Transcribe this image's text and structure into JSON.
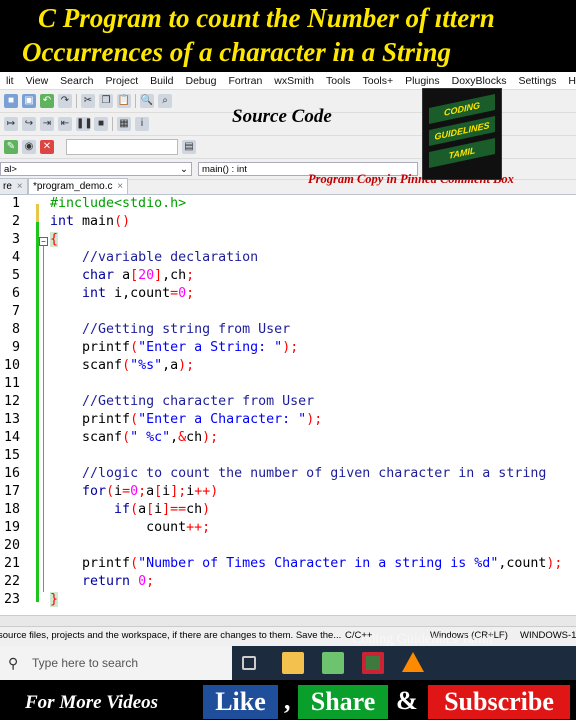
{
  "banner": {
    "line1": "C Program to count the Number of ıttern",
    "line2": "Occurrences of a character in a String"
  },
  "menu": [
    "lit",
    "View",
    "Search",
    "Project",
    "Build",
    "Debug",
    "Fortran",
    "wxSmith",
    "Tools",
    "Tools+",
    "Plugins",
    "DoxyBlocks",
    "Settings",
    "Help"
  ],
  "toolbar_combo": {
    "scope_value": "al>",
    "function_value": "main() : int"
  },
  "tabs": [
    {
      "label": "re",
      "close": "×"
    },
    {
      "label": "*program_demo.c",
      "close": "×"
    }
  ],
  "overlay": {
    "source_code_title": "Source Code",
    "pinned_note": "Program Copy in Pinned Comment Box"
  },
  "logo": {
    "line1": "CODING",
    "line2": "GUIDELINES",
    "line3": "TAMIL"
  },
  "code": {
    "line_numbers": [
      "1",
      "2",
      "3",
      "4",
      "5",
      "6",
      "7",
      "8",
      "9",
      "10",
      "11",
      "12",
      "13",
      "14",
      "15",
      "16",
      "17",
      "18",
      "19",
      "20",
      "21",
      "22",
      "23"
    ]
  },
  "statusbar": {
    "message": "source files, projects and the workspace, if there are changes to them. Save the...",
    "language": "C/C++",
    "eol": "Windows (CR+LF)",
    "encoding": "WINDOWS-1"
  },
  "taskbar": {
    "search_placeholder": "Type here to search"
  },
  "watermark": "Coding Guidelines Tamil",
  "footer": {
    "more_videos": "For More Videos",
    "like": "Like",
    "comma": ",",
    "share": "Share",
    "ampersand": "&",
    "subscribe": "Subscribe",
    "like_color": "#1f4e9a",
    "share_color": "#0a9e2a",
    "subscribe_color": "#e01515"
  }
}
